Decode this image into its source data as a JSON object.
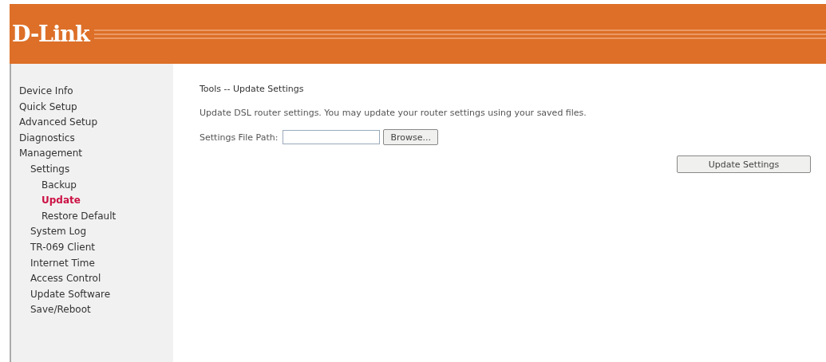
{
  "header": {
    "logo": "D-Link"
  },
  "sidebar": {
    "items": [
      {
        "label": "Device Info",
        "selected": false
      },
      {
        "label": "Quick Setup",
        "selected": false
      },
      {
        "label": "Advanced Setup",
        "selected": false
      },
      {
        "label": "Diagnostics",
        "selected": false
      },
      {
        "label": "Management",
        "selected": false,
        "children": [
          {
            "label": "Settings",
            "selected": false,
            "children": [
              {
                "label": "Backup",
                "selected": false
              },
              {
                "label": "Update",
                "selected": true
              },
              {
                "label": "Restore Default",
                "selected": false
              }
            ]
          },
          {
            "label": "System Log",
            "selected": false
          },
          {
            "label": "TR-069 Client",
            "selected": false
          },
          {
            "label": "Internet Time",
            "selected": false
          },
          {
            "label": "Access Control",
            "selected": false
          },
          {
            "label": "Update Software",
            "selected": false
          },
          {
            "label": "Save/Reboot",
            "selected": false
          }
        ]
      }
    ]
  },
  "content": {
    "title": "Tools -- Update Settings",
    "description": "Update DSL router settings. You may update your router settings using your saved files.",
    "file_field": {
      "label": "Settings File Path:",
      "browse_button": "Browse..."
    },
    "submit_button": "Update Settings"
  }
}
